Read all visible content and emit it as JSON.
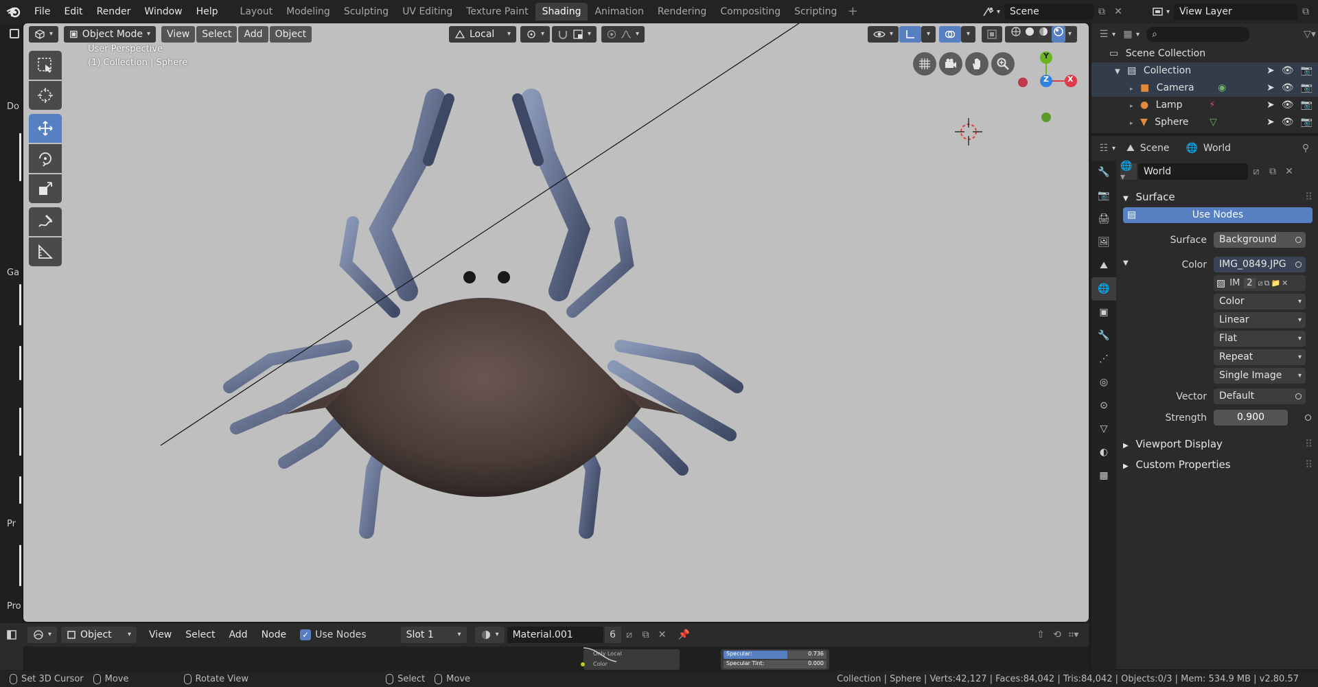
{
  "topbar": {
    "menus": [
      "File",
      "Edit",
      "Render",
      "Window",
      "Help"
    ],
    "workspaces": [
      "Layout",
      "Modeling",
      "Sculpting",
      "UV Editing",
      "Texture Paint",
      "Shading",
      "Animation",
      "Rendering",
      "Compositing",
      "Scripting"
    ],
    "active_workspace": "Shading",
    "scene_name": "Scene",
    "view_layer": "View Layer"
  },
  "left_strip": {
    "labels": [
      "Do",
      "Ga",
      "Pr",
      "Pro"
    ]
  },
  "viewport": {
    "mode": "Object Mode",
    "menus": [
      "View",
      "Select",
      "Add",
      "Object"
    ],
    "transform_orientation": "Local",
    "info_line1": "User Perspective",
    "info_line2": "(1) Collection | Sphere",
    "gizmo": {
      "x": "X",
      "y": "Y",
      "z": "Z"
    },
    "colors": {
      "background": "#bfbfbf",
      "x_axis": "#e0394a",
      "y_axis": "#6bb31f",
      "z_axis": "#2f82e0",
      "active_tool": "#5680c2"
    },
    "tools": [
      "select-box",
      "cursor",
      "move",
      "rotate",
      "scale",
      "annotate",
      "measure"
    ],
    "active_tool": "move"
  },
  "outliner": {
    "root": "Scene Collection",
    "collection": "Collection",
    "items": [
      {
        "name": "Camera",
        "icon": "camera-icon"
      },
      {
        "name": "Lamp",
        "icon": "lamp-icon"
      },
      {
        "name": "Sphere",
        "icon": "mesh-icon"
      }
    ]
  },
  "properties": {
    "breadcrumb_scene": "Scene",
    "breadcrumb_world": "World",
    "world_name": "World",
    "surface_panel": "Surface",
    "use_nodes_label": "Use Nodes",
    "rows": {
      "surface_label": "Surface",
      "surface_value": "Background",
      "color_label": "Color",
      "color_value": "IMG_0849.JPG",
      "image_short": "IM",
      "image_users": "2",
      "color_space": "Color",
      "interpolation": "Linear",
      "projection": "Flat",
      "extension": "Repeat",
      "source": "Single Image",
      "vector_label": "Vector",
      "vector_value": "Default",
      "strength_label": "Strength",
      "strength_value": "0.900"
    },
    "viewport_display": "Viewport Display",
    "custom_properties": "Custom Properties"
  },
  "node_editor": {
    "type": "Object",
    "menus": [
      "View",
      "Select",
      "Add",
      "Node"
    ],
    "use_nodes": "Use Nodes",
    "slot": "Slot 1",
    "material": "Material.001",
    "users": "6",
    "node_labels": {
      "only_local": "Only Local",
      "color": "Color",
      "specular": "Specular:",
      "specular_value": "0.736",
      "specular_tint": "Specular Tint:",
      "specular_tint_value": "0.000"
    }
  },
  "statusbar": {
    "set_cursor": "Set 3D Cursor",
    "move": "Move",
    "rotate_view": "Rotate View",
    "select": "Select",
    "move2": "Move",
    "stats": "Collection | Sphere | Verts:42,127 | Faces:84,042 | Tris:84,042 | Objects:0/3 | Mem: 534.9 MB | v2.80.57"
  }
}
